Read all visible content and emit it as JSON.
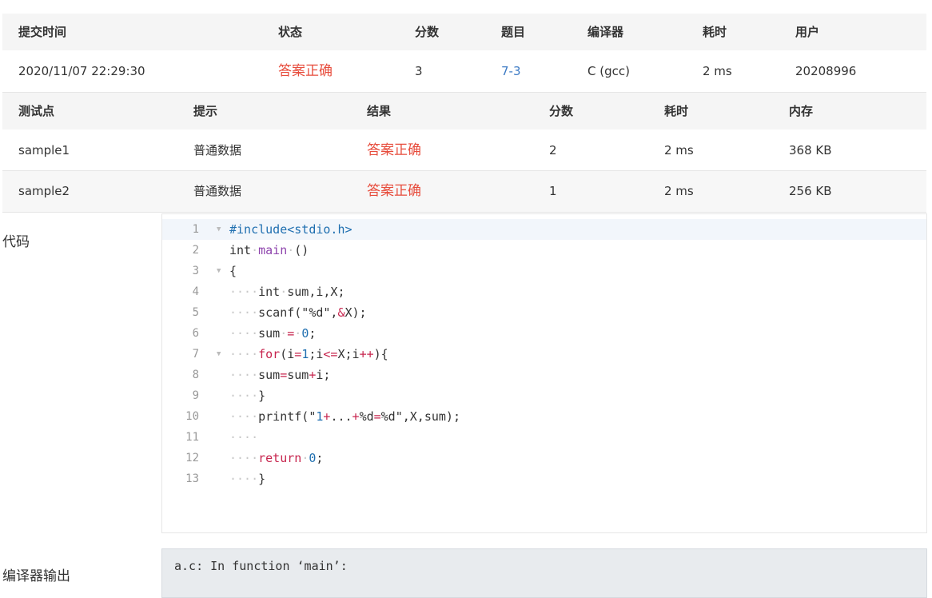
{
  "submission": {
    "headers": {
      "time": "提交时间",
      "status": "状态",
      "score": "分数",
      "problem": "题目",
      "compiler": "编译器",
      "elapsed": "耗时",
      "user": "用户"
    },
    "row": {
      "time": "2020/11/07 22:29:30",
      "status": "答案正确",
      "score": "3",
      "problem": "7-3",
      "compiler": "C (gcc)",
      "elapsed": "2 ms",
      "user": "20208996"
    }
  },
  "testcases": {
    "headers": {
      "point": "测试点",
      "hint": "提示",
      "result": "结果",
      "score": "分数",
      "elapsed": "耗时",
      "memory": "内存"
    },
    "rows": [
      {
        "point": "sample1",
        "hint": "普通数据",
        "result": "答案正确",
        "score": "2",
        "elapsed": "2 ms",
        "memory": "368 KB"
      },
      {
        "point": "sample2",
        "hint": "普通数据",
        "result": "答案正确",
        "score": "1",
        "elapsed": "2 ms",
        "memory": "256 KB"
      }
    ]
  },
  "code": {
    "label": "代码",
    "lines": [
      {
        "no": "1",
        "text": "#include<stdio.h>"
      },
      {
        "no": "2",
        "text": "int main ()"
      },
      {
        "no": "3",
        "text": "{"
      },
      {
        "no": "4",
        "text": "    int sum,i,X;"
      },
      {
        "no": "5",
        "text": "    scanf(\"%d\",&X);"
      },
      {
        "no": "6",
        "text": "    sum = 0;"
      },
      {
        "no": "7",
        "text": "    for(i=1;i<=X;i++){"
      },
      {
        "no": "8",
        "text": "    sum=sum+i;"
      },
      {
        "no": "9",
        "text": "    }"
      },
      {
        "no": "10",
        "text": "    printf(\"1+...+%d=%d\",X,sum);"
      },
      {
        "no": "11",
        "text": "    "
      },
      {
        "no": "12",
        "text": "    return 0;"
      },
      {
        "no": "13",
        "text": "    }"
      }
    ]
  },
  "compiler_output": {
    "label": "编译器输出",
    "text": "a.c: In function ‘main’:"
  },
  "colors": {
    "accepted": "#e74c3c",
    "problem_link": "#3c7ac4"
  }
}
